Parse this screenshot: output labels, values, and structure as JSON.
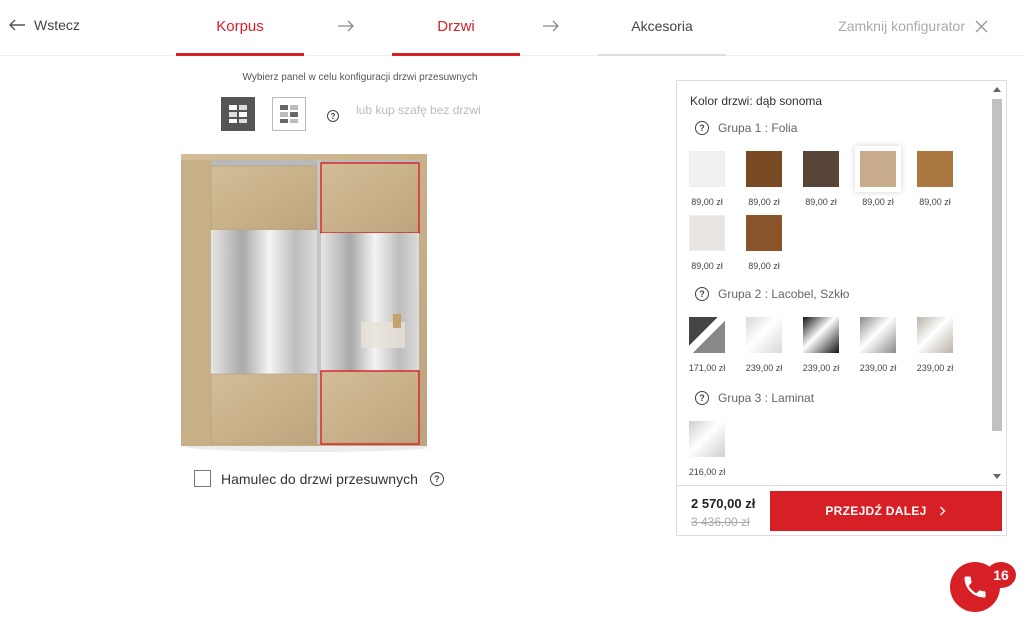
{
  "nav": {
    "back_label": "Wstecz",
    "steps": [
      "Korpus",
      "Drzwi",
      "Akcesoria"
    ],
    "close_label": "Zamknij konfigurator"
  },
  "left": {
    "instruction": "Wybierz panel w celu konfiguracji drzwi przesuwnych",
    "no_doors_label": "lub kup szafę bez drzwi",
    "help_glyph": "?",
    "brake_label": "Hamulec do drzwi przesuwnych",
    "brake_checked": false
  },
  "config": {
    "door_color_label": "Kolor drzwi: dąb sonoma",
    "groups": [
      {
        "title": "Grupa 1 : Folia",
        "items": [
          {
            "price": "89,00 zł",
            "color": "#f1f1f1"
          },
          {
            "price": "89,00 zł",
            "color": "#7a4a24"
          },
          {
            "price": "89,00 zł",
            "color": "#5a4438"
          },
          {
            "price": "89,00 zł",
            "color": "#c8ab8a",
            "selected": true
          },
          {
            "price": "89,00 zł",
            "color": "#a9773f"
          },
          {
            "price": "89,00 zł",
            "color": "#e8e4df"
          },
          {
            "price": "89,00 zł",
            "color": "#8a552b"
          }
        ]
      },
      {
        "title": "Grupa 2 : Lacobel, Szkło",
        "items": [
          {
            "price": "171,00 zł",
            "color": "#777777"
          },
          {
            "price": "239,00 zł",
            "color": "#d8d8d8"
          },
          {
            "price": "239,00 zł",
            "color": "#111111"
          },
          {
            "price": "239,00 zł",
            "color": "#8a8a8a"
          },
          {
            "price": "239,00 zł",
            "color": "#b8b2a6"
          }
        ]
      },
      {
        "title": "Grupa 3 : Laminat",
        "items": [
          {
            "price": "216,00 zł",
            "color": "#cfcfcf"
          }
        ]
      }
    ],
    "price_now": "2 570,00 zł",
    "price_old": "3 436,00 zł",
    "next_label": "PRZEJDŹ DALEJ"
  },
  "phone_badge": "16",
  "colors": {
    "accent": "#d71f26"
  }
}
